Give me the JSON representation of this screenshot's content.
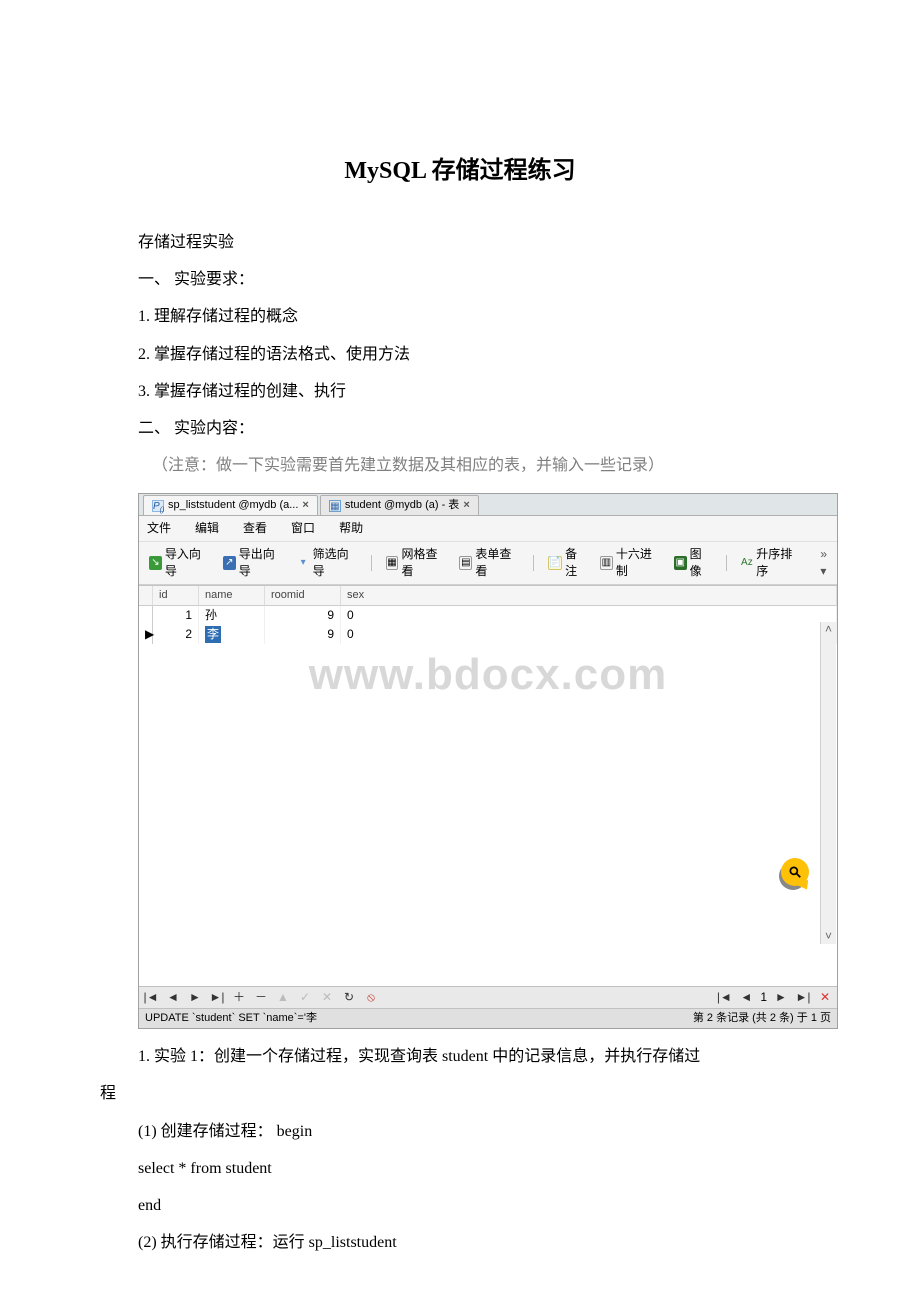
{
  "doc": {
    "title": "MySQL 存储过程练习",
    "p_intro": "存储过程实验",
    "p_req_head": "一、 实验要求：",
    "p_req1": "1. 理解存储过程的概念",
    "p_req2": "2. 掌握存储过程的语法格式、使用方法",
    "p_req3": "3. 掌握存储过程的创建、执行",
    "p_content_head": "二、 实验内容：",
    "p_note": "（注意：做一下实验需要首先建立数据及其相应的表，并输入一些记录）",
    "p_exp1": "1. 实验 1：创建一个存储过程，实现查询表 student 中的记录信息，并执行存储过",
    "p_exp1_cont": "程",
    "p_step1": "(1) 创建存储过程：  begin",
    "p_step1_sql": " select * from student",
    "p_step1_end": "   end",
    "p_step2": "(2) 执行存储过程：运行 sp_liststudent"
  },
  "app": {
    "tab1": "sp_liststudent @mydb (a...",
    "tab2": "student @mydb (a) - 表",
    "menu": {
      "file": "文件",
      "edit": "编辑",
      "view": "查看",
      "window": "窗口",
      "help": "帮助"
    },
    "toolbar": {
      "import": "导入向导",
      "export": "导出向导",
      "filter": "筛选向导",
      "gridview": "网格查看",
      "formview": "表单查看",
      "memo": "备注",
      "hex": "十六进制",
      "image": "图像",
      "sort": "升序排序"
    },
    "cols": {
      "id": "id",
      "name": "name",
      "roomid": "roomid",
      "sex": "sex"
    },
    "rows": [
      {
        "id": "1",
        "name": "孙",
        "roomid": "9",
        "sex": "0"
      },
      {
        "id": "2",
        "name": "李",
        "roomid": "9",
        "sex": "0"
      }
    ],
    "watermark": "www.bdocx.com",
    "sql": "UPDATE `student` SET `name`='李",
    "record": "第 2 条记录 (共 2 条) 于 1 页",
    "page_no": "1"
  }
}
